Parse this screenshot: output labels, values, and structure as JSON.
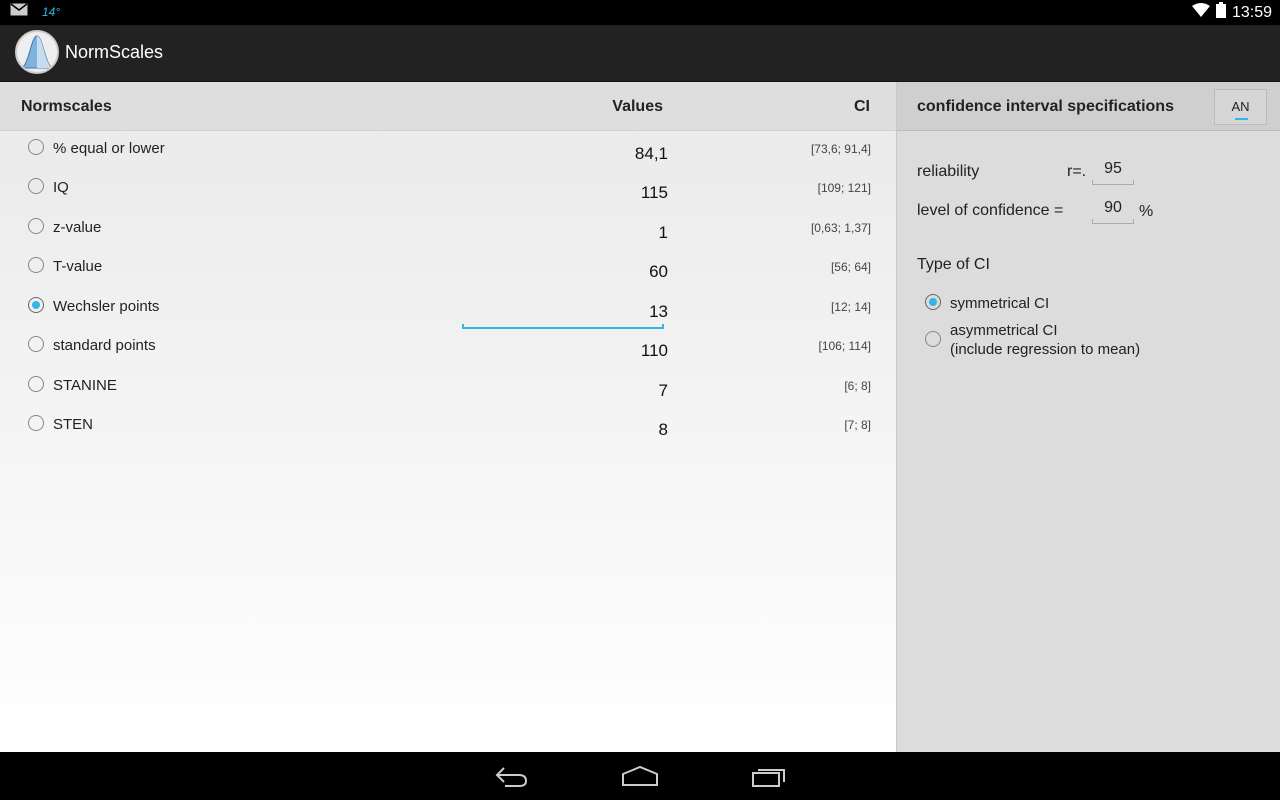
{
  "status_bar": {
    "temperature": "14°",
    "time": "13:59",
    "icons": [
      "gmail-icon",
      "wifi-icon",
      "battery-icon"
    ]
  },
  "app": {
    "title": "NormScales"
  },
  "table": {
    "headers": {
      "scale": "Normscales",
      "values": "Values",
      "ci": "CI"
    },
    "rows": [
      {
        "label": "% equal or lower",
        "value": "84,1",
        "ci": "[73,6; 91,4]",
        "selected": false
      },
      {
        "label": "IQ",
        "value": "115",
        "ci": "[109; 121]",
        "selected": false
      },
      {
        "label": "z-value",
        "value": "1",
        "ci": "[0,63; 1,37]",
        "selected": false
      },
      {
        "label": "T-value",
        "value": "60",
        "ci": "[56; 64]",
        "selected": false
      },
      {
        "label": "Wechsler points",
        "value": "13",
        "ci": "[12; 14]",
        "selected": true
      },
      {
        "label": "standard points",
        "value": "110",
        "ci": "[106; 114]",
        "selected": false
      },
      {
        "label": "STANINE",
        "value": "7",
        "ci": "[6; 8]",
        "selected": false
      },
      {
        "label": "STEN",
        "value": "8",
        "ci": "[7; 8]",
        "selected": false
      }
    ]
  },
  "side": {
    "title": "confidence interval specifications",
    "an_button": "AN",
    "reliability_label": "reliability",
    "reliability_prefix": "r=.",
    "reliability_value": "95",
    "confidence_label": "level of confidence =",
    "confidence_value": "90",
    "confidence_unit": "%",
    "type_label": "Type of CI",
    "options": [
      {
        "label": "symmetrical CI",
        "sub": "",
        "selected": true
      },
      {
        "label": "asymmetrical CI",
        "sub": "(include regression to mean)",
        "selected": false
      }
    ]
  },
  "colors": {
    "accent": "#33b5e5",
    "action_bar": "#222222",
    "side_panel": "#dcdcdc"
  }
}
